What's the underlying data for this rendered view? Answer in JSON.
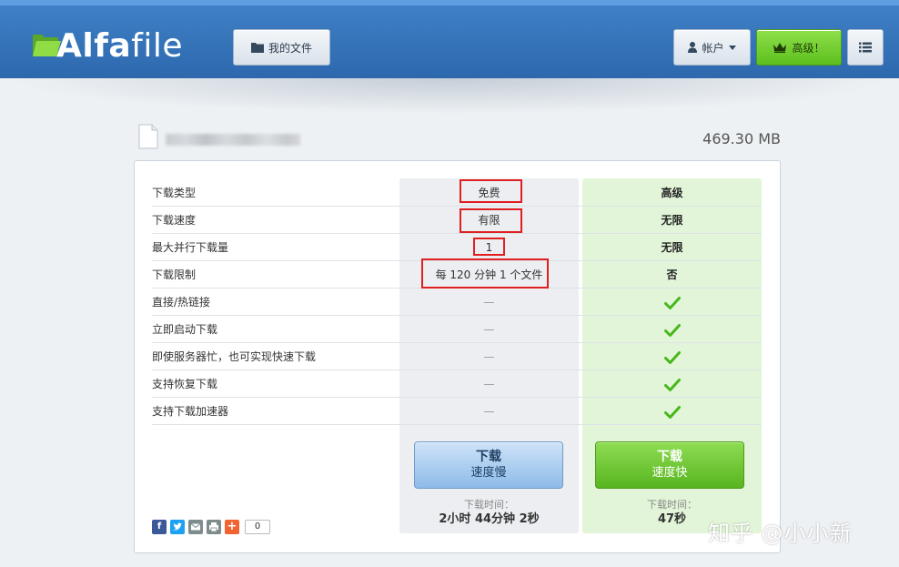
{
  "header": {
    "logo_prefix": "A",
    "logo_mid": "lfa",
    "logo_suffix": "file",
    "my_files_label": "我的文件",
    "account_label": "帐户",
    "premium_label": "高级！",
    "colors": {
      "header_bg": "#3674bb",
      "premium_btn": "#6fcb2e",
      "logo_icon": "#7ed23a"
    }
  },
  "file": {
    "size": "469.30 MB"
  },
  "comparison": {
    "rows": [
      {
        "label": "下载类型",
        "free": "免费",
        "premium": "高级"
      },
      {
        "label": "下载速度",
        "free": "有限",
        "premium": "无限"
      },
      {
        "label": "最大并行下载量",
        "free": "1",
        "premium": "无限"
      },
      {
        "label": "下载限制",
        "free": "每 120 分钟 1 个文件",
        "premium": "否"
      },
      {
        "label": "直接/热链接",
        "free": "—",
        "premium": "check"
      },
      {
        "label": "立即启动下载",
        "free": "—",
        "premium": "check"
      },
      {
        "label": "即使服务器忙，也可实现快速下载",
        "free": "—",
        "premium": "check"
      },
      {
        "label": "支持恢复下载",
        "free": "—",
        "premium": "check"
      },
      {
        "label": "支持下载加速器",
        "free": "—",
        "premium": "check"
      }
    ]
  },
  "slow_download": {
    "line1": "下载",
    "line2": "速度慢",
    "time_label": "下载时间：",
    "time_value": "2小时 44分钟 2秒"
  },
  "fast_download": {
    "line1": "下载",
    "line2": "速度快",
    "time_label": "下载时间：",
    "time_value": "47秒"
  },
  "share": {
    "count": "0",
    "icons": [
      "facebook-icon",
      "twitter-icon",
      "email-icon",
      "print-icon",
      "more-icon"
    ]
  },
  "watermark": "知乎 @小小新"
}
